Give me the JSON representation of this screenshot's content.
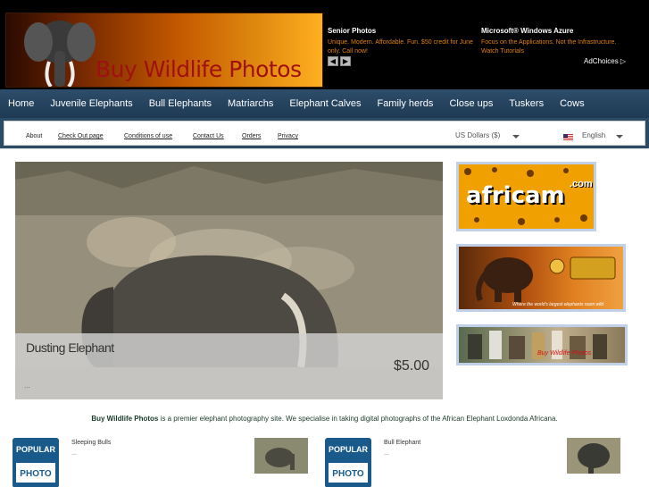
{
  "header": {
    "site_title": "Buy Wildlife Photos",
    "ad1": {
      "title": "Senior Photos",
      "text": "Unique. Modern. Affordable. Fun. $50 credit for June only. Call now!"
    },
    "ad2": {
      "title": "Microsoft® Windows Azure",
      "text": "Focus on the Applications. Not the Infrastructure. Watch Tutorials"
    },
    "ad_prev": "◀",
    "ad_next": "▶",
    "adchoices": "AdChoices ▷"
  },
  "nav": {
    "items": [
      "Home",
      "Juvenile Elephants",
      "Bull Elephants",
      "Matriarchs",
      "Elephant Calves",
      "Family herds",
      "Close ups",
      "Tuskers",
      "Cows"
    ]
  },
  "subnav": {
    "links": [
      "About",
      "Check Out page",
      "Conditions of use",
      "Contact Us",
      "Orders",
      "Privacy"
    ],
    "currency": "US Dollars ($)",
    "language": "English"
  },
  "hero": {
    "title": "Dusting Elephant",
    "price": "$5.00",
    "dots": "..."
  },
  "side_ads": {
    "africam": "africam",
    "africam_com": ".com",
    "tembe_caption": "Where the world's largest elephants roam wild",
    "animals_caption": "Buy Wildlife Photos"
  },
  "intro": {
    "brand": "Buy Wildlife Photos",
    "text": " is a premier elephant photography site. We specialise in taking digital photographs of the African Elephant Loxdonda Africana."
  },
  "popular": [
    {
      "badge_top": "POPULAR",
      "badge_bottom": "PHOTO",
      "name": "Sleeping Bulls",
      "dots": "..."
    },
    {
      "badge_top": "POPULAR",
      "badge_bottom": "PHOTO",
      "name": "Bull Elephant",
      "dots": "..."
    }
  ],
  "colors": {
    "nav_bg": "#2d4d6a",
    "title_red": "#a01010",
    "ad_orange": "#e08010"
  }
}
